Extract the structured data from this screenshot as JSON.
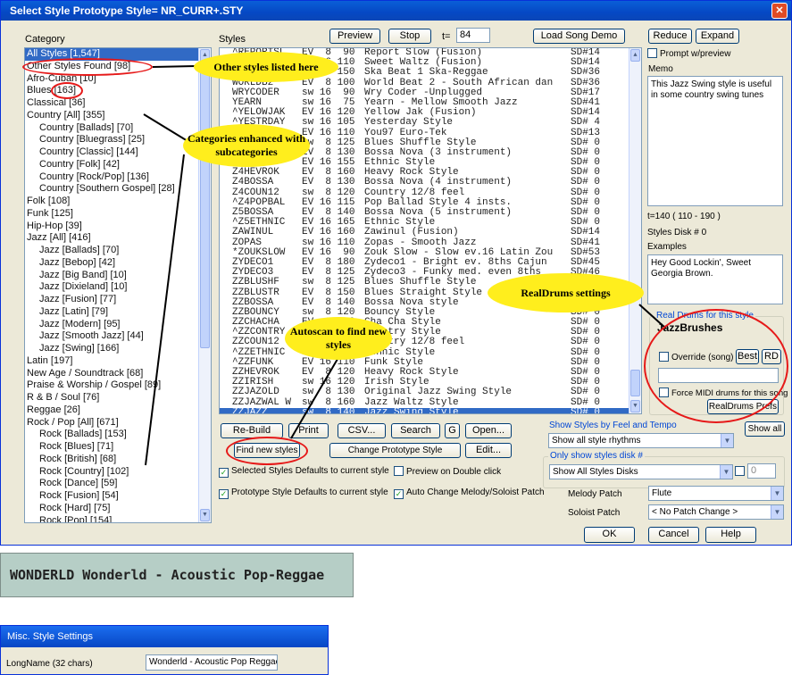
{
  "window": {
    "title": "Select Style Prototype Style= NR_CURR+.STY",
    "close_glyph": "✕"
  },
  "category": {
    "label": "Category",
    "items": [
      {
        "text": "All Styles [1,547]",
        "sub": false,
        "sel": true
      },
      {
        "text": "Other Styles Found [98]",
        "sub": false
      },
      {
        "text": "Afro-Cuban [10]",
        "sub": false
      },
      {
        "text": "Blues [163]",
        "sub": false
      },
      {
        "text": "Classical [36]",
        "sub": false
      },
      {
        "text": "Country [All] [355]",
        "sub": false
      },
      {
        "text": "Country [Ballads] [70]",
        "sub": true
      },
      {
        "text": "Country [Bluegrass] [25]",
        "sub": true
      },
      {
        "text": "Country [Classic] [144]",
        "sub": true
      },
      {
        "text": "Country [Folk] [42]",
        "sub": true
      },
      {
        "text": "Country [Rock/Pop] [136]",
        "sub": true
      },
      {
        "text": "Country [Southern Gospel] [28]",
        "sub": true
      },
      {
        "text": "Folk [108]",
        "sub": false
      },
      {
        "text": "Funk [125]",
        "sub": false
      },
      {
        "text": "Hip-Hop [39]",
        "sub": false
      },
      {
        "text": "Jazz [All] [416]",
        "sub": false
      },
      {
        "text": "Jazz [Ballads] [70]",
        "sub": true
      },
      {
        "text": "Jazz [Bebop] [42]",
        "sub": true
      },
      {
        "text": "Jazz [Big Band] [10]",
        "sub": true
      },
      {
        "text": "Jazz [Dixieland] [10]",
        "sub": true
      },
      {
        "text": "Jazz [Fusion] [77]",
        "sub": true
      },
      {
        "text": "Jazz [Latin] [79]",
        "sub": true
      },
      {
        "text": "Jazz [Modern] [95]",
        "sub": true
      },
      {
        "text": "Jazz [Smooth Jazz] [44]",
        "sub": true
      },
      {
        "text": "Jazz [Swing] [166]",
        "sub": true
      },
      {
        "text": "Latin [197]",
        "sub": false
      },
      {
        "text": "New Age / Soundtrack [68]",
        "sub": false
      },
      {
        "text": "Praise & Worship / Gospel [89]",
        "sub": false
      },
      {
        "text": "R & B / Soul [76]",
        "sub": false
      },
      {
        "text": "Reggae [26]",
        "sub": false
      },
      {
        "text": "Rock / Pop [All] [671]",
        "sub": false
      },
      {
        "text": "Rock [Ballads] [153]",
        "sub": true
      },
      {
        "text": "Rock [Blues] [71]",
        "sub": true
      },
      {
        "text": "Rock [British] [68]",
        "sub": true
      },
      {
        "text": "Rock [Country] [102]",
        "sub": true
      },
      {
        "text": "Rock [Dance] [59]",
        "sub": true
      },
      {
        "text": "Rock [Fusion] [54]",
        "sub": true
      },
      {
        "text": "Rock [Hard] [75]",
        "sub": true
      },
      {
        "text": "Rock [Pop] [154]",
        "sub": true
      }
    ]
  },
  "styles": {
    "label": "Styles",
    "preview": "Preview",
    "stop": "Stop",
    "tempo_label": "t=",
    "tempo_value": "84",
    "load_song_demo": "Load Song Demo",
    "rows": [
      {
        "name": "^REPORTSL",
        "type": "EV",
        "feel": " 8",
        "tempo": " 90",
        "desc": "Report Slow (Fusion)",
        "disk": "SD#14"
      },
      {
        "name": "^SWETWALZ",
        "type": "EV",
        "feel": "16",
        "tempo": "110",
        "desc": "Sweet Waltz (Fusion)",
        "disk": "SD#14"
      },
      {
        "name": "^SKA1",
        "type": "EV",
        "feel": " 8",
        "tempo": "150",
        "desc": "Ska Beat 1 Ska-Reggae",
        "disk": "SD#36"
      },
      {
        "name": "WORLDB2",
        "type": "EV",
        "feel": " 8",
        "tempo": "100",
        "desc": "World Beat 2 - South African dan",
        "disk": "SD#36"
      },
      {
        "name": "WRYCODER",
        "type": "sw",
        "feel": "16",
        "tempo": " 90",
        "desc": "Wry Coder -Unplugged",
        "disk": "SD#17"
      },
      {
        "name": "YEARN",
        "type": "sw",
        "feel": "16",
        "tempo": " 75",
        "desc": "Yearn - Mellow Smooth Jazz",
        "disk": "SD#41"
      },
      {
        "name": "^YELOWJAK",
        "type": "EV",
        "feel": "16",
        "tempo": "120",
        "desc": "Yellow Jak (Fusion)",
        "disk": "SD#14"
      },
      {
        "name": "^YESTRDAY",
        "type": "sw",
        "feel": "16",
        "tempo": "105",
        "desc": "Yesterday Style",
        "disk": "SD# 4"
      },
      {
        "name": "^YOU97",
        "type": "EV",
        "feel": "16",
        "tempo": "110",
        "desc": "You97 Euro-Tek",
        "disk": "SD#13"
      },
      {
        "name": "Z4BLUSHF",
        "type": "sw",
        "feel": " 8",
        "tempo": "125",
        "desc": "Blues Shuffle Style",
        "disk": "SD# 0"
      },
      {
        "name": "Z3BOSSA",
        "type": "EV",
        "feel": " 8",
        "tempo": "130",
        "desc": "Bossa Nova (3 instrument)",
        "disk": "SD# 0"
      },
      {
        "name": "Z4ETHNIC",
        "type": "EV",
        "feel": "16",
        "tempo": "155",
        "desc": "Ethnic Style",
        "disk": "SD# 0"
      },
      {
        "name": "Z4HEVROK",
        "type": "EV",
        "feel": " 8",
        "tempo": "160",
        "desc": "Heavy Rock Style",
        "disk": "SD# 0"
      },
      {
        "name": "Z4BOSSA",
        "type": "EV",
        "feel": " 8",
        "tempo": "130",
        "desc": "Bossa Nova (4 instrument)",
        "disk": "SD# 0"
      },
      {
        "name": "Z4COUN12",
        "type": "sw",
        "feel": " 8",
        "tempo": "120",
        "desc": "Country 12/8 feel",
        "disk": "SD# 0"
      },
      {
        "name": "^Z4POPBAL",
        "type": "EV",
        "feel": "16",
        "tempo": "115",
        "desc": "Pop Ballad Style 4 insts.",
        "disk": "SD# 0"
      },
      {
        "name": "Z5BOSSA",
        "type": "EV",
        "feel": " 8",
        "tempo": "140",
        "desc": "Bossa Nova (5 instrument)",
        "disk": "SD# 0"
      },
      {
        "name": "^Z5ETHNIC",
        "type": "EV",
        "feel": "16",
        "tempo": "165",
        "desc": "Ethnic Style",
        "disk": "SD# 0"
      },
      {
        "name": "ZAWINUL",
        "type": "EV",
        "feel": "16",
        "tempo": "160",
        "desc": "Zawinul (Fusion)",
        "disk": "SD#14"
      },
      {
        "name": "ZOPAS",
        "type": "sw",
        "feel": "16",
        "tempo": "110",
        "desc": "Zopas - Smooth Jazz",
        "disk": "SD#41"
      },
      {
        "name": "*ZOUKSLOW",
        "type": "EV",
        "feel": "16",
        "tempo": " 90",
        "desc": "Zouk Slow - Slow ev.16 Latin Zou",
        "disk": "SD#53"
      },
      {
        "name": "ZYDECO1",
        "type": "EV",
        "feel": " 8",
        "tempo": "180",
        "desc": "Zydeco1 - Bright ev. 8ths Cajun",
        "disk": "SD#45"
      },
      {
        "name": "ZYDECO3",
        "type": "EV",
        "feel": " 8",
        "tempo": "125",
        "desc": "Zydeco3 - Funky med. even 8ths",
        "disk": "SD#46"
      },
      {
        "name": "ZZBLUSHF",
        "type": "sw",
        "feel": " 8",
        "tempo": "125",
        "desc": "Blues Shuffle Style",
        "disk": "SD# 0"
      },
      {
        "name": "ZZBLUSTR",
        "type": "EV",
        "feel": " 8",
        "tempo": "150",
        "desc": "Blues Straight Style",
        "disk": "SD# 0"
      },
      {
        "name": "ZZBOSSA",
        "type": "EV",
        "feel": " 8",
        "tempo": "140",
        "desc": "Bossa Nova style",
        "disk": "SD# 0"
      },
      {
        "name": "ZZBOUNCY",
        "type": "sw",
        "feel": " 8",
        "tempo": "120",
        "desc": "Bouncy Style",
        "disk": "SD# 0"
      },
      {
        "name": "ZZCHACHA",
        "type": "EV",
        "feel": " 8",
        "tempo": "120",
        "desc": "Cha Cha Style",
        "disk": "SD# 0"
      },
      {
        "name": "^ZZCONTRY",
        "type": "EV",
        "feel": " 8",
        "tempo": "130",
        "desc": "Country Style",
        "disk": "SD# 0"
      },
      {
        "name": "ZZCOUN12",
        "type": "sw",
        "feel": " 8",
        "tempo": "120",
        "desc": "Country 12/8 feel",
        "disk": "SD# 0"
      },
      {
        "name": "^ZZETHNIC",
        "type": "EV",
        "feel": "16",
        "tempo": "165",
        "desc": "Ethnic Style",
        "disk": "SD# 0"
      },
      {
        "name": "^ZZFUNK",
        "type": "EV",
        "feel": "16",
        "tempo": "110",
        "desc": "Funk Style",
        "disk": "SD# 0"
      },
      {
        "name": "ZZHEVROK",
        "type": "EV",
        "feel": " 8",
        "tempo": "120",
        "desc": "Heavy Rock Style",
        "disk": "SD# 0"
      },
      {
        "name": "ZZIRISH",
        "type": "sw",
        "feel": "16",
        "tempo": "120",
        "desc": "Irish Style",
        "disk": "SD# 0"
      },
      {
        "name": "ZZJAZOLD",
        "type": "sw",
        "feel": " 8",
        "tempo": "130",
        "desc": "Original Jazz Swing Style",
        "disk": "SD# 0"
      },
      {
        "name": "ZZJAZWAL W",
        "type": "sw",
        "feel": " 8",
        "tempo": "160",
        "desc": "Jazz Waltz Style",
        "disk": "SD# 0"
      },
      {
        "name": "ZZJAZZ",
        "type": "sw",
        "feel": " 8",
        "tempo": "140",
        "desc": "Jazz Swing Style",
        "disk": "SD# 0",
        "sel": true
      }
    ]
  },
  "right": {
    "reduce": "Reduce",
    "expand": "Expand",
    "prompt_preview": "Prompt w/preview",
    "memo_label": "Memo",
    "memo_text": "This Jazz Swing style is useful in some country swing tunes",
    "tempo_range": "t=140 ( 110 - 190 )",
    "styles_disk": "Styles Disk # 0",
    "examples_label": "Examples",
    "examples_text": "Hey Good Lockin', Sweet Georgia Brown.",
    "realdrums_group": "Real Drums for this style",
    "realdrums_name": "JazzBrushes",
    "override": "Override (song)",
    "best": "Best",
    "rd": "RD",
    "force_midi": "Force MIDI drums for this song",
    "realdrums_prefs": "RealDrums Prefs"
  },
  "buttons": {
    "rebuild": "Re-Build",
    "print": "Print",
    "csv": "CSV...",
    "search": "Search",
    "g": "G",
    "open": "Open...",
    "find_new": "Find new styles",
    "change_proto": "Change Prototype Style",
    "edit": "Edit..."
  },
  "filters": {
    "feel_label": "Show Styles by Feel and Tempo",
    "show_all": "Show all",
    "feel_value": "Show all style rhythms",
    "disk_label": "Only show styles disk #",
    "disk_value": "Show All Styles Disks",
    "disk_num": "0"
  },
  "checks": {
    "selected_defaults": "Selected Styles Defaults to current style",
    "preview_dbl": "Preview on Double click",
    "proto_defaults": "Prototype Style Defaults to current style",
    "auto_change": "Auto Change Melody/Soloist Patch"
  },
  "patches": {
    "melody_label": "Melody Patch",
    "melody_value": "Flute",
    "soloist_label": "Soloist Patch",
    "soloist_value": "< No Patch Change >"
  },
  "footer": {
    "ok": "OK",
    "cancel": "Cancel",
    "help": "Help"
  },
  "callouts": {
    "other_styles": "Other styles listed here",
    "categories": "Categories enhanced with subcategories",
    "realdrums": "RealDrums settings",
    "autoscan": "Autoscan to find new styles"
  },
  "longname_strip": "WONDERLD Wonderld - Acoustic Pop-Reggae",
  "misc": {
    "title": "Misc. Style Settings",
    "longname_label": "LongName (32 chars)",
    "longname_value": "Wonderld - Acoustic Pop Reggae"
  }
}
